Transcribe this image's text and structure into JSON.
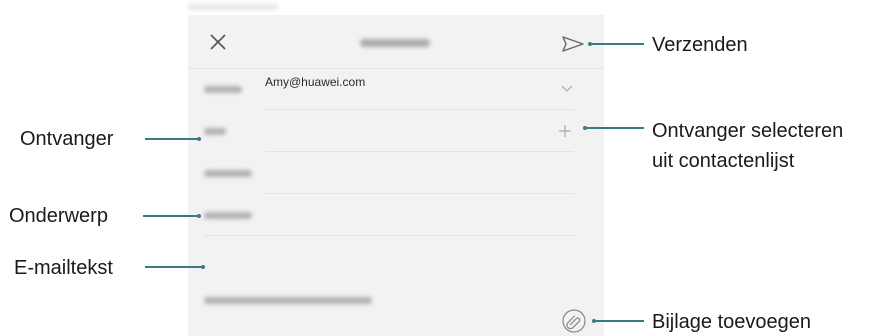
{
  "email": {
    "from_value": "Amy@huawei.com"
  },
  "callouts": {
    "send": "Verzenden",
    "recipient": "Ontvanger",
    "select_contacts_line1": "Ontvanger selecteren",
    "select_contacts_line2": "uit contactenlijst",
    "subject": "Onderwerp",
    "body": "E-mailtekst",
    "attach": "Bijlage toevoegen"
  },
  "colors": {
    "callout_line": "#3a7a7e",
    "screen_bg": "#f2f2f2"
  },
  "icons": [
    "close-icon",
    "send-icon",
    "chevron-down-icon",
    "plus-icon",
    "attachment-icon"
  ]
}
